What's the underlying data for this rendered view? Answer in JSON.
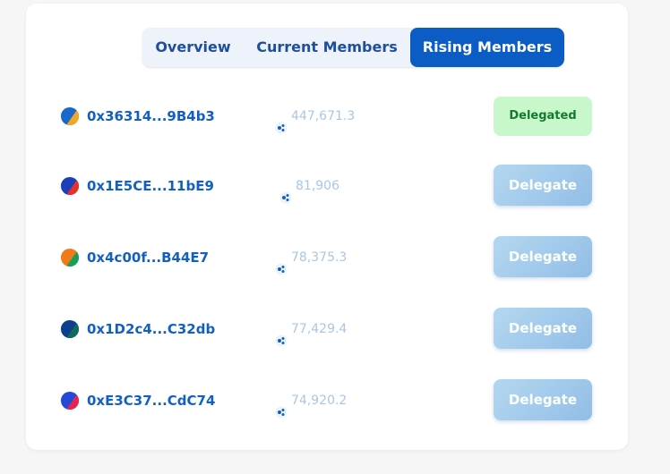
{
  "tabs": [
    {
      "label": "Overview"
    },
    {
      "label": "Current Members"
    },
    {
      "label": "Rising Members",
      "active": true
    }
  ],
  "members": [
    {
      "address": "0x36314...9B4b3",
      "amount": "447,671.3",
      "action": "Delegated",
      "avatar_colors": [
        "#1a68c8",
        "#f5a623"
      ]
    },
    {
      "address": "0x1E5CE...11bE9",
      "amount": "81,906",
      "action": "Delegate",
      "avatar_colors": [
        "#1a3fb8",
        "#e8302a"
      ]
    },
    {
      "address": "0x4c00f...B44E7",
      "amount": "78,375.3",
      "action": "Delegate",
      "avatar_colors": [
        "#f07a18",
        "#14a05a"
      ]
    },
    {
      "address": "0x1D2c4...C32db",
      "amount": "77,429.4",
      "action": "Delegate",
      "avatar_colors": [
        "#0c3f8c",
        "#0e6a5a"
      ]
    },
    {
      "address": "0xE3C37...CdC74",
      "amount": "74,920.2",
      "action": "Delegate",
      "avatar_colors": [
        "#2449d8",
        "#e8244e"
      ]
    }
  ],
  "icons": {
    "amount": "token-icon"
  },
  "colors": {
    "accent": "#0b5cc4",
    "address": "#1460c0",
    "delegated_bg": "#c8f7cc",
    "delegated_text": "#127a2a",
    "delegate_bg": "#a5cbeb"
  }
}
